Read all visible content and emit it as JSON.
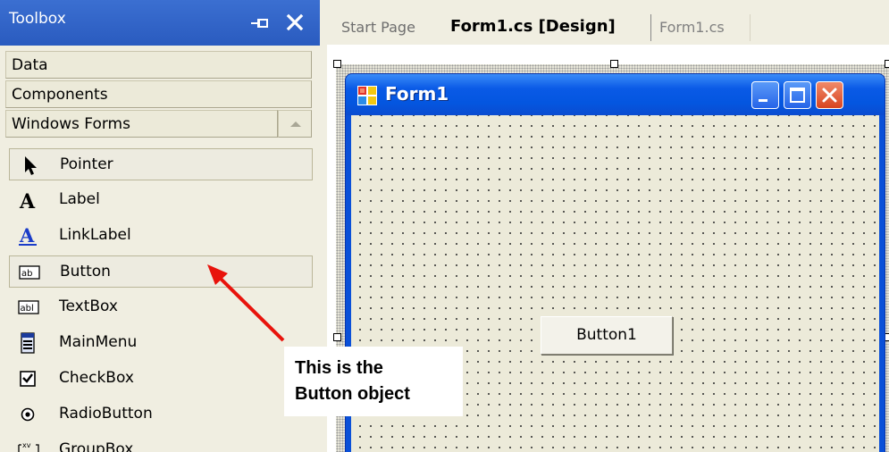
{
  "toolbox": {
    "title": "Toolbox",
    "categories": [
      "Data",
      "Components",
      "Windows Forms"
    ],
    "items": [
      {
        "label": "Pointer",
        "icon": "pointer-icon"
      },
      {
        "label": "Label",
        "icon": "label-icon"
      },
      {
        "label": "LinkLabel",
        "icon": "linklabel-icon"
      },
      {
        "label": "Button",
        "icon": "button-icon"
      },
      {
        "label": "TextBox",
        "icon": "textbox-icon"
      },
      {
        "label": "MainMenu",
        "icon": "mainmenu-icon"
      },
      {
        "label": "CheckBox",
        "icon": "checkbox-icon"
      },
      {
        "label": "RadioButton",
        "icon": "radiobutton-icon"
      },
      {
        "label": "GroupBox",
        "icon": "groupbox-icon"
      }
    ]
  },
  "tabs": [
    "Start Page",
    "Form1.cs [Design]",
    "Form1.cs"
  ],
  "form": {
    "title": "Form1",
    "button_label": "Button1"
  },
  "annotation": {
    "line1": "This is the",
    "line2": "Button object"
  },
  "colors": {
    "title_bar": "#0a5ae6",
    "arrow": "#e8130c",
    "toolbox_header": "#2f62c8"
  }
}
